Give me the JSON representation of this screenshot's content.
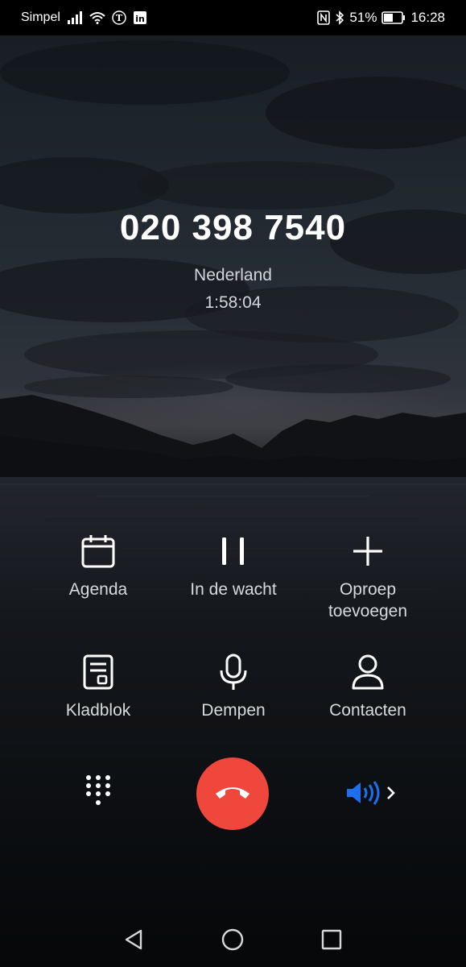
{
  "status_bar": {
    "carrier": "Simpel",
    "battery": "51%",
    "time": "16:28",
    "icons": [
      "signal-icon",
      "wifi-icon",
      "telegraaf-icon",
      "linkedin-icon",
      "nfc-icon",
      "bluetooth-icon",
      "battery-icon"
    ]
  },
  "call": {
    "number": "020 398 7540",
    "country": "Nederland",
    "duration": "1:58:04"
  },
  "actions": [
    {
      "label": "Agenda",
      "icon": "calendar-icon"
    },
    {
      "label": "In de wacht",
      "icon": "pause-icon"
    },
    {
      "label": "Oproep toevoegen",
      "icon": "plus-icon"
    },
    {
      "label": "Kladblok",
      "icon": "notepad-icon"
    },
    {
      "label": "Dempen",
      "icon": "microphone-icon"
    },
    {
      "label": "Contacten",
      "icon": "contacts-icon"
    }
  ],
  "controls": {
    "dialpad_icon": "dialpad-icon",
    "end_call_icon": "end-call-icon",
    "speaker_icon": "speaker-icon",
    "end_call_color": "#f0473c",
    "speaker_color": "#1e6ff0"
  },
  "navigation": {
    "icons": [
      "back-icon",
      "home-icon",
      "recents-icon"
    ]
  }
}
